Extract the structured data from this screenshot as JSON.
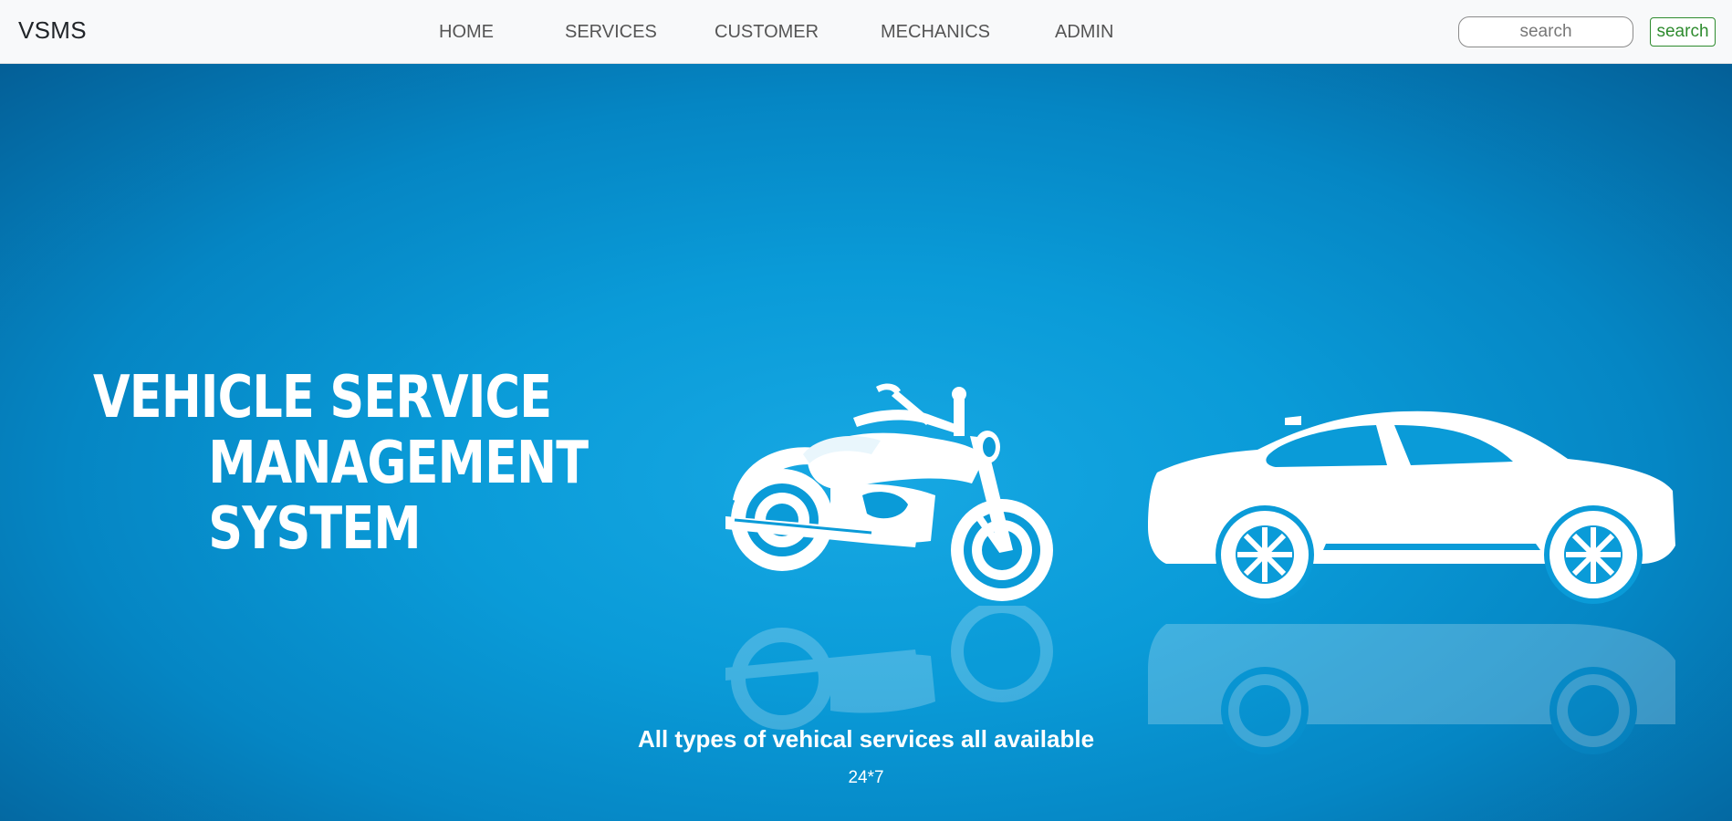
{
  "navbar": {
    "brand": "VSMS",
    "links": [
      "HOME",
      "SERVICES",
      "CUSTOMER",
      "MECHANICS",
      "ADMIN"
    ],
    "search_placeholder": "search",
    "search_button": "search"
  },
  "hero": {
    "title_lines": [
      "VEHICLE SERVICE",
      "MANAGEMENT",
      "SYSTEM"
    ],
    "caption_title": "All types of vehical services all available",
    "caption_sub": "24*7"
  },
  "colors": {
    "hero_blue": "#0a9bd8",
    "search_green": "#2e8b2e",
    "navbar_bg": "#f8f9fa"
  },
  "icons": [
    "motorcycle-icon",
    "car-icon"
  ]
}
